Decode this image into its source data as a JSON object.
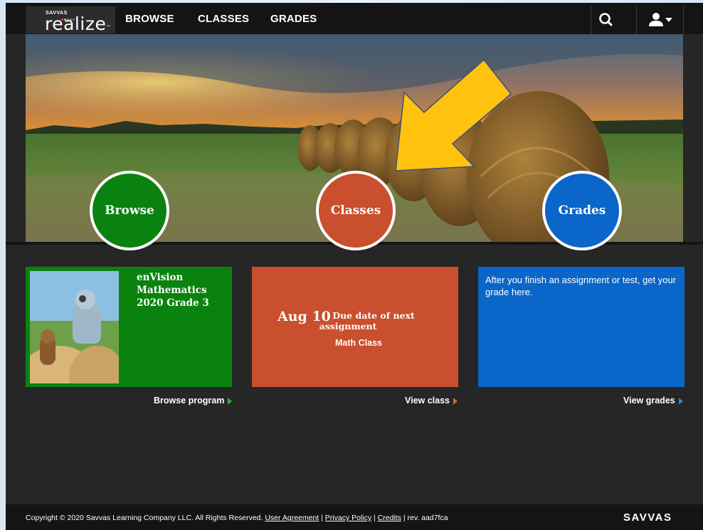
{
  "brand": {
    "logo_top": "SAVVAS",
    "logo_word": "realize",
    "logo_tm": "™",
    "footer_brand": "SAVVAS"
  },
  "nav": {
    "browse": "BROWSE",
    "classes": "CLASSES",
    "grades": "GRADES"
  },
  "hero": {
    "circles": {
      "browse": "Browse",
      "classes": "Classes",
      "grades": "Grades"
    }
  },
  "cards": {
    "browse": {
      "title": "enVision Mathematics 2020 Grade 3",
      "link": "Browse program"
    },
    "classes": {
      "due_date": "Aug 10",
      "due_label_1": "Due date of next",
      "due_label_2": "assignment",
      "class_name": "Math Class",
      "link": "View class"
    },
    "grades": {
      "message": "After you finish an assignment or test, get your grade here.",
      "link": "View grades"
    }
  },
  "footer": {
    "copyright": "Copyright © 2020 Savvas Learning Company LLC. All Rights Reserved.",
    "user_agreement": "User Agreement",
    "privacy_policy": "Privacy Policy",
    "credits": "Credits",
    "revision": "rev. aad7fca"
  },
  "colors": {
    "browse": "#0a820f",
    "classes": "#c94f2e",
    "grades": "#0a66c8",
    "topbar": "#141414",
    "page": "#262626",
    "annotation_arrow": "#ffc20e"
  },
  "icons": {
    "search": "search-icon",
    "user": "user-icon",
    "caret": "caret-down-icon"
  }
}
